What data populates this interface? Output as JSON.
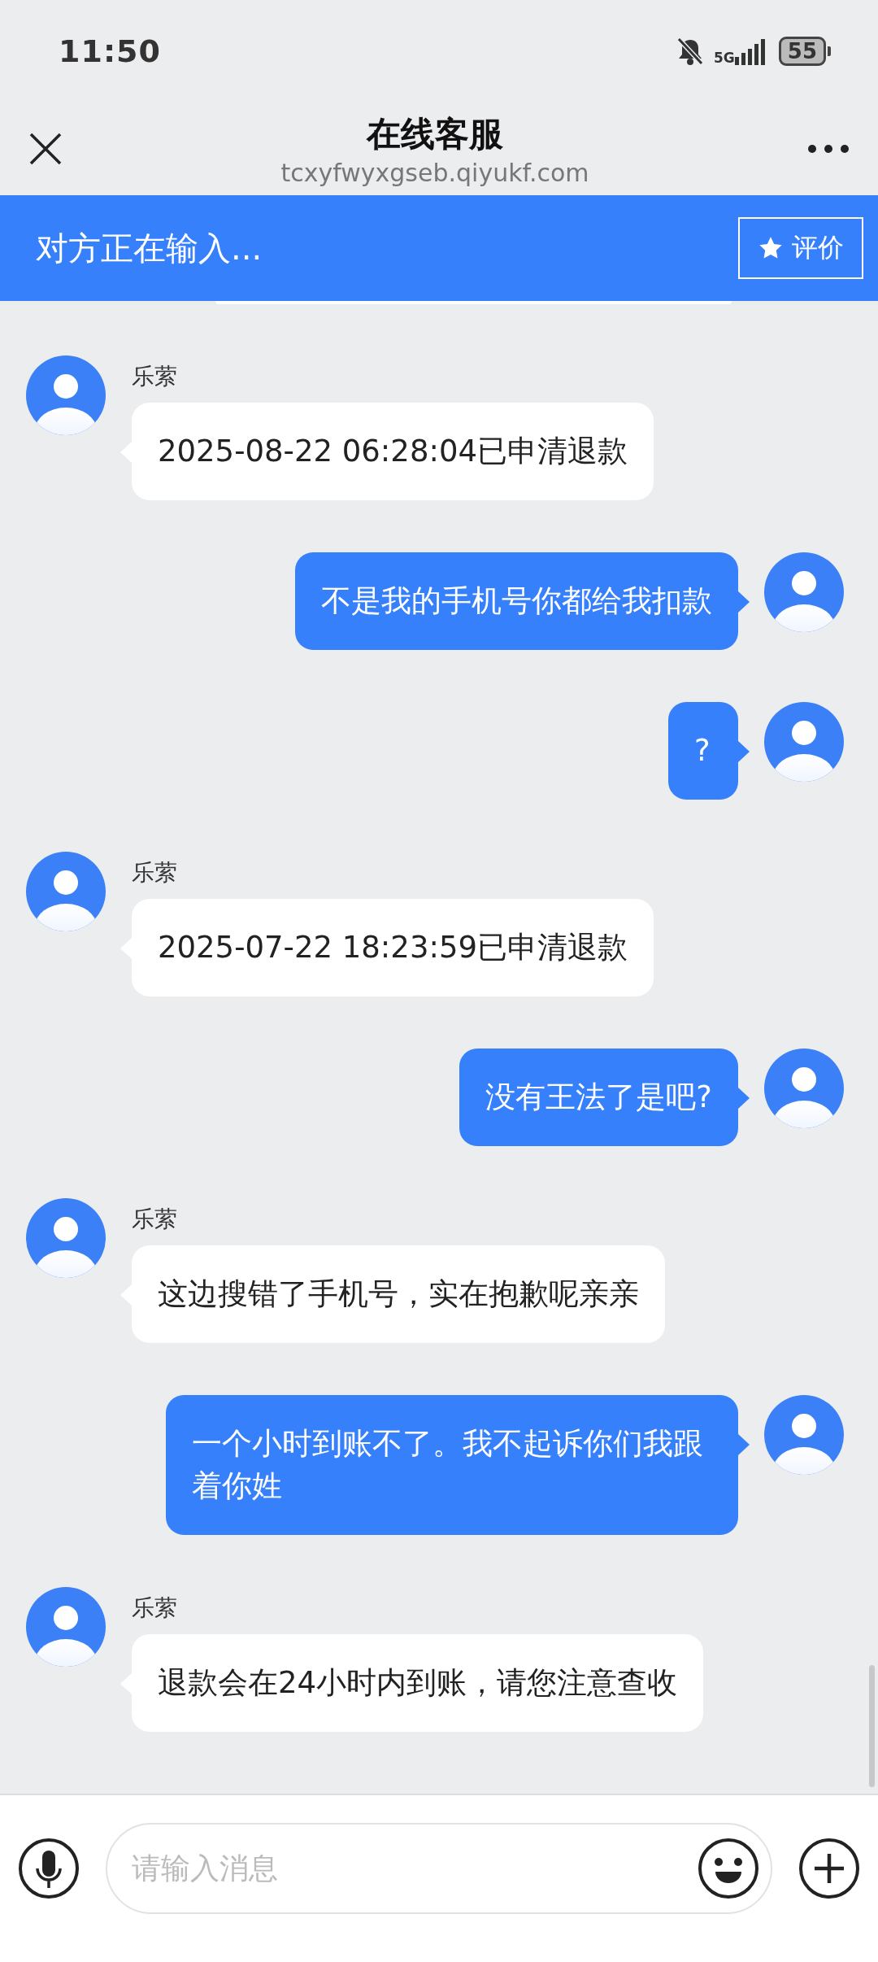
{
  "status_bar": {
    "time": "11:50",
    "network": "5G",
    "battery": "55"
  },
  "header": {
    "title": "在线客服",
    "subtitle": "tcxyfwyxgseb.qiyukf.com"
  },
  "typing_bar": {
    "text": "对方正在输入...",
    "rate_button": "评价"
  },
  "messages": [
    {
      "kind": "agent",
      "name": "乐萦",
      "text": "2025-08-22 06:28:04已申清退款"
    },
    {
      "kind": "user",
      "text": "不是我的手机号你都给我扣款"
    },
    {
      "kind": "user",
      "text": "?"
    },
    {
      "kind": "agent",
      "name": "乐萦",
      "text": "2025-07-22 18:23:59已申清退款"
    },
    {
      "kind": "user",
      "text": "没有王法了是吧?"
    },
    {
      "kind": "agent",
      "name": "乐萦",
      "text": "这边搜错了手机号，实在抱歉呢亲亲"
    },
    {
      "kind": "user",
      "text": "一个小时到账不了。我不起诉你们我跟着你姓"
    },
    {
      "kind": "agent",
      "name": "乐萦",
      "text": "退款会在24小时内到账，请您注意查收"
    }
  ],
  "input": {
    "placeholder": "请输入消息"
  }
}
